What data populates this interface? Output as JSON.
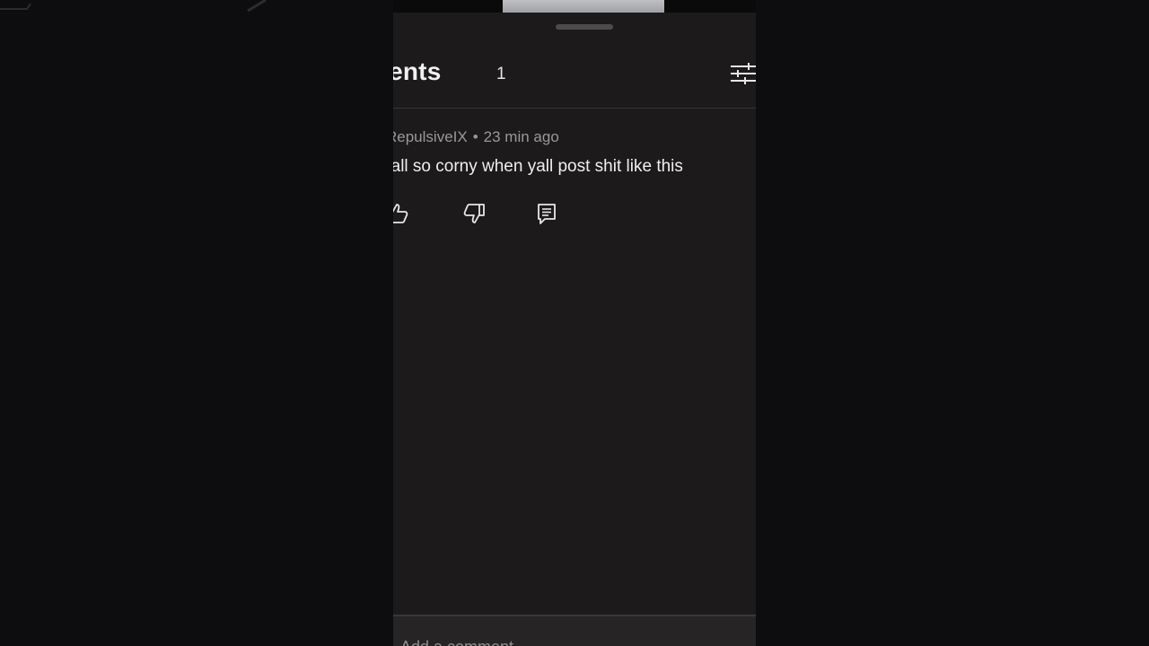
{
  "comments_panel": {
    "title": "Comments",
    "title_visible": "ments",
    "count": "1",
    "add_comment_placeholder": "Add a comment..."
  },
  "comment": {
    "author": "@RepulsiveIX",
    "author_visible": "RepulsiveIX",
    "time": "23 min ago",
    "separator": "•",
    "text": "Yall so corny when yall post shit like this",
    "text_visible": "'all so corny when yall post shit like this"
  },
  "icons": {
    "filter": "sliders-icon",
    "like": "thumbs-up-icon",
    "dislike": "thumbs-down-icon",
    "reply": "reply-comment-icon",
    "handle": "drag-handle"
  },
  "colors": {
    "background": "#0b0a0c",
    "sheet": "#1c1a1b",
    "text_primary": "#efefef",
    "text_secondary": "#9a9899"
  }
}
